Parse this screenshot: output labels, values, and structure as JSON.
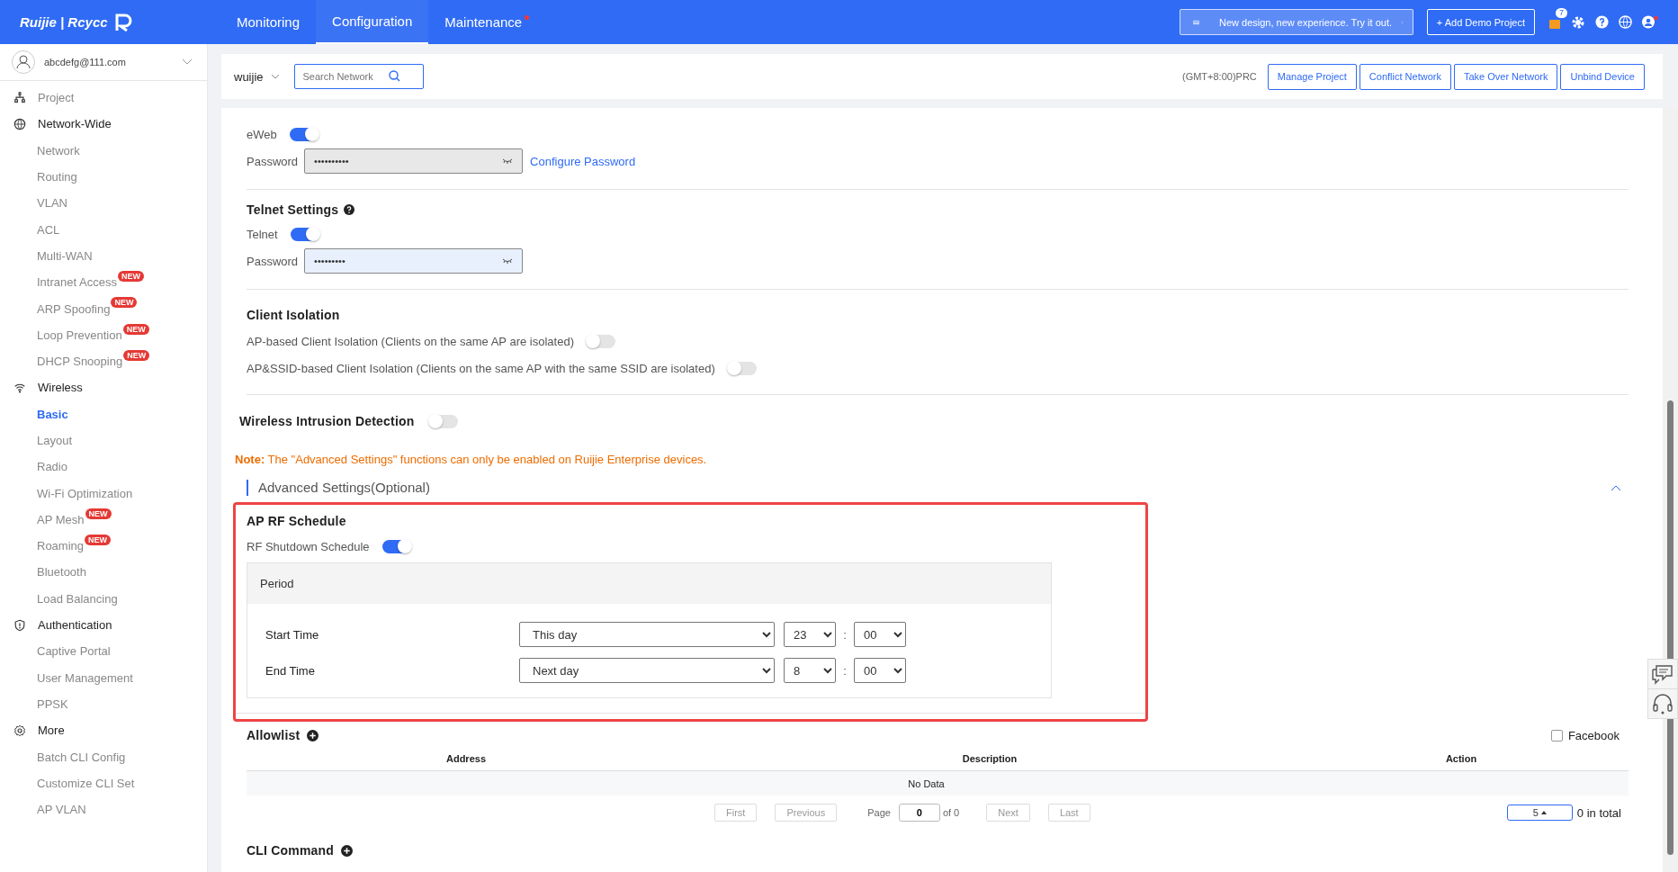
{
  "header": {
    "logo": "Ruijie | Rcycc",
    "nav": [
      {
        "label": "Monitoring",
        "selected": false,
        "dot": false
      },
      {
        "label": "Configuration",
        "selected": true,
        "dot": false
      },
      {
        "label": "Maintenance",
        "selected": false,
        "dot": true
      }
    ],
    "banner": "New design, new experience. Try it out.",
    "add_button": "+ Add Demo Project",
    "notification_count": "7"
  },
  "sidebar": {
    "account": "abcdefg@111.com",
    "groups": [
      {
        "label": "Project"
      },
      {
        "label": "Network-Wide",
        "children": [
          {
            "label": "Network",
            "selected": false
          },
          {
            "label": "Routing",
            "selected": false
          },
          {
            "label": "VLAN",
            "selected": false
          },
          {
            "label": "ACL",
            "selected": false
          },
          {
            "label": "Multi-WAN",
            "selected": false
          },
          {
            "label": "Intranet Access",
            "selected": false,
            "badge": "NEW"
          },
          {
            "label": "ARP Spoofing",
            "selected": false,
            "badge": "NEW"
          },
          {
            "label": "Loop Prevention",
            "selected": false,
            "badge": "NEW"
          },
          {
            "label": "DHCP Snooping",
            "selected": false,
            "badge": "NEW"
          }
        ]
      },
      {
        "label": "Wireless",
        "children": [
          {
            "label": "Basic",
            "selected": true
          },
          {
            "label": "Layout",
            "selected": false
          },
          {
            "label": "Radio",
            "selected": false
          },
          {
            "label": "Wi-Fi Optimization",
            "selected": false
          },
          {
            "label": "AP Mesh",
            "selected": false,
            "badge": "NEW"
          },
          {
            "label": "Roaming",
            "selected": false,
            "badge": "NEW"
          },
          {
            "label": "Bluetooth",
            "selected": false
          },
          {
            "label": "Load Balancing",
            "selected": false
          }
        ]
      },
      {
        "label": "Authentication",
        "children": [
          {
            "label": "Captive Portal",
            "selected": false
          },
          {
            "label": "User Management",
            "selected": false
          },
          {
            "label": "PPSK",
            "selected": false
          }
        ]
      },
      {
        "label": "More",
        "children": [
          {
            "label": "Batch CLI Config",
            "selected": false
          },
          {
            "label": "Customize CLI Set",
            "selected": false
          },
          {
            "label": "AP VLAN",
            "selected": false
          }
        ]
      }
    ]
  },
  "toolbar": {
    "network": "wuijie",
    "search_placeholder": "Search Network",
    "timezone": "(GMT+8:00)PRC",
    "buttons": [
      "Manage Project",
      "Conflict Network",
      "Take Over Network",
      "Unbind Device"
    ]
  },
  "eweb": {
    "toggle": {
      "label": "eWeb",
      "on": true
    },
    "password": {
      "label": "Password",
      "value": "••••••••••",
      "disabled": true
    },
    "link": "Configure Password"
  },
  "telnet": {
    "title": "Telnet Settings",
    "toggle": {
      "label": "Telnet",
      "on": true
    },
    "password": {
      "label": "Password",
      "value": "•••••••••",
      "disabled": false
    }
  },
  "client_isolation": {
    "title": "Client Isolation",
    "toggles": [
      {
        "label": "AP-based Client Isolation (Clients on the same AP are isolated)",
        "on": false
      },
      {
        "label": "AP&SSID-based Client Isolation (Clients on the same AP with the same SSID are isolated)",
        "on": false
      }
    ]
  },
  "intrusion_detection": {
    "label": "Wireless Intrusion Detection",
    "on": false
  },
  "note": "**Note:** The \"Advanced Settings\" functions can only be enabled on Ruijie Enterprise devices.",
  "advanced": {
    "title": "Advanced Settings(Optional)",
    "expanded": true
  },
  "rf_schedule": {
    "title": "AP RF Schedule",
    "toggle": {
      "label": "RF Shutdown Schedule",
      "on": true
    },
    "period": {
      "title": "Period",
      "separator": ":",
      "rows": [
        {
          "label": "Start Time",
          "day": "This day",
          "hour": "23",
          "minute": "00"
        },
        {
          "label": "End Time",
          "day": "Next day",
          "hour": "8",
          "minute": "00"
        }
      ]
    }
  },
  "allowlist": {
    "title": "Allowlist",
    "facebook": {
      "label": "Facebook",
      "checked": false
    },
    "columns": [
      "Address",
      "Description",
      "Action"
    ],
    "empty": "No Data",
    "pagination": {
      "first": "First",
      "previous": "Previous",
      "page_label": "Page",
      "page": "0",
      "of": "of 0",
      "next": "Next",
      "last": "Last",
      "page_size": "5",
      "total": "0 in total"
    }
  },
  "cli": {
    "title": "CLI Command"
  }
}
